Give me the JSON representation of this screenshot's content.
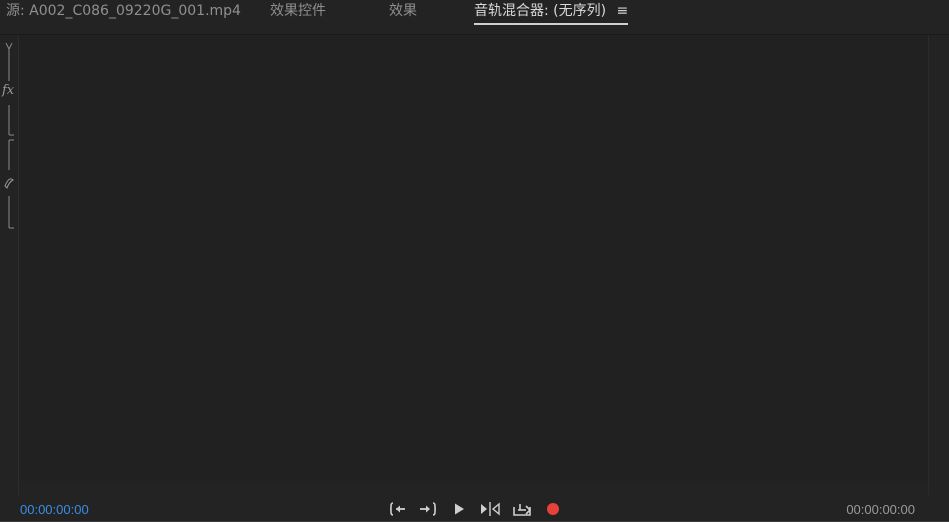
{
  "tabs": [
    {
      "label": "源: A002_C086_09220G_001.mp4",
      "active": false
    },
    {
      "label": "效果控件",
      "active": false
    },
    {
      "label": "效果",
      "active": false
    },
    {
      "label": "音轨混合器: (无序列)",
      "active": true
    }
  ],
  "tab_menu_icon": "hamburger-menu-icon",
  "transport": {
    "timecode_left": "00:00:00:00",
    "timecode_right": "00:00:00:00",
    "buttons": [
      "go-to-in-icon",
      "go-to-out-icon",
      "play-icon",
      "loop-icon",
      "export-icon",
      "record-icon"
    ]
  },
  "side_labels": {
    "fx": "fx"
  },
  "colors": {
    "background": "#232323",
    "timecode_active": "#3a8ee6",
    "record": "#e8413b"
  }
}
